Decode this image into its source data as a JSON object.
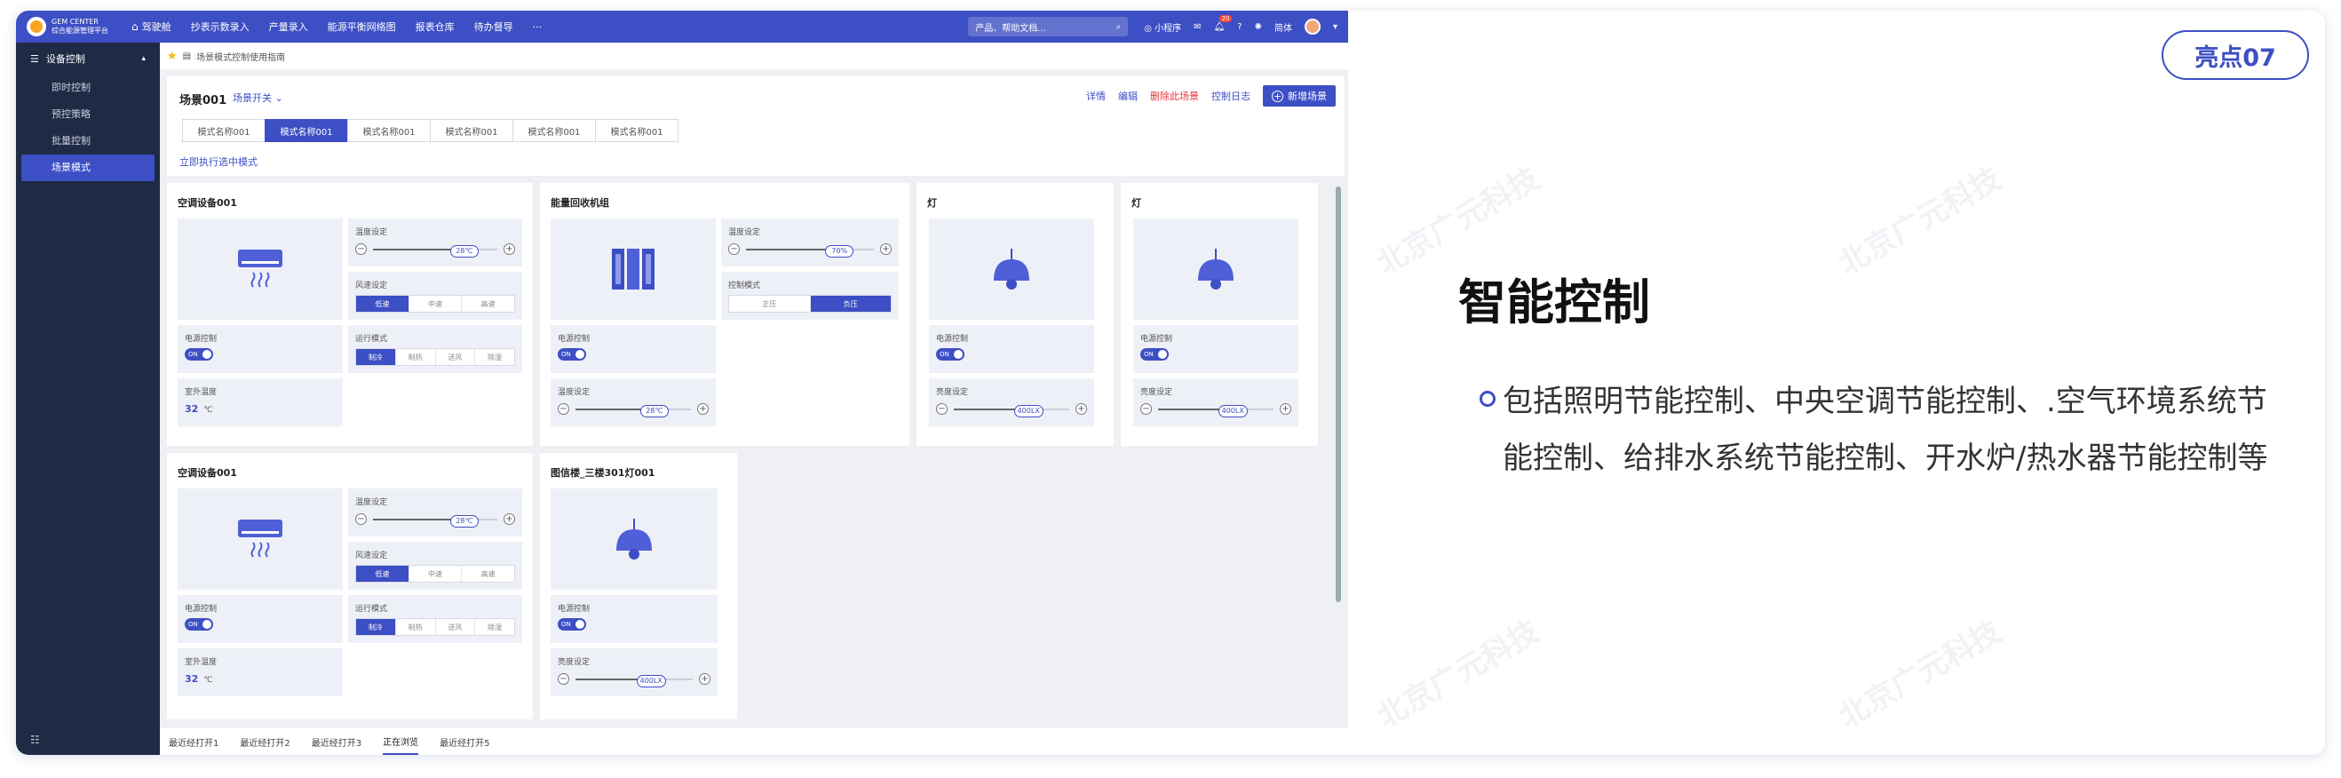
{
  "app": {
    "logo_text": "GEM CENTER",
    "logo_sub": "综合能源管理平台",
    "nav": [
      {
        "label": "驾驶舱",
        "icon": "home-icon"
      },
      {
        "label": "抄表示数录入"
      },
      {
        "label": "产量录入"
      },
      {
        "label": "能源平衡网络图"
      },
      {
        "label": "报表仓库"
      },
      {
        "label": "待办督导"
      },
      {
        "label": "···"
      }
    ],
    "search_placeholder": "产品、帮助文档...",
    "mini_program": "小程序",
    "notif_count": "20",
    "lang": "简体"
  },
  "sidebar": {
    "header": "设备控制",
    "items": [
      "即时控制",
      "预控策略",
      "批量控制",
      "场景模式"
    ],
    "active_index": 3
  },
  "breadcrumb": "场景模式控制使用指南",
  "scene": {
    "title": "场景001",
    "switch_label": "场景开关",
    "actions": [
      "详情",
      "编辑",
      "删除此场景",
      "控制日志"
    ],
    "add_label": "新增场景",
    "tabs": [
      "模式名称001",
      "模式名称001",
      "模式名称001",
      "模式名称001",
      "模式名称001",
      "模式名称001"
    ],
    "active_tab": 1,
    "exec_link": "立即执行选中模式"
  },
  "labels": {
    "temp_set": "温度设定",
    "fan_set": "风速设定",
    "power": "电源控制",
    "run_mode": "运行模式",
    "outdoor_temp": "室外温度",
    "control_mode": "控制模式",
    "brightness": "亮度设定"
  },
  "devices": {
    "ac1": {
      "title": "空调设备001",
      "temp": "28℃",
      "fan": [
        "低速",
        "中速",
        "高速"
      ],
      "fan_on": 0,
      "power": "ON",
      "modes": [
        "制冷",
        "制热",
        "送风",
        "除湿"
      ],
      "mode_on": 0,
      "outdoor": "32",
      "unit": "℃"
    },
    "recovery": {
      "title": "能量回收机组",
      "temp": "70%",
      "ctrl": [
        "正压",
        "负压"
      ],
      "ctrl_on": 1,
      "power": "ON",
      "temp2": "28℃"
    },
    "lamp1": {
      "title": "灯",
      "power": "ON",
      "bright": "400LX"
    },
    "lamp2": {
      "title": "灯",
      "power": "ON",
      "bright": "400LX"
    },
    "ac2": {
      "title": "空调设备001",
      "temp": "28℃",
      "fan": [
        "低速",
        "中速",
        "高速"
      ],
      "fan_on": 0,
      "power": "ON",
      "modes": [
        "制冷",
        "制热",
        "送风",
        "除湿"
      ],
      "mode_on": 0,
      "outdoor": "32",
      "unit": "℃"
    },
    "lamp3": {
      "title": "图信楼_三楼301灯001",
      "power": "ON",
      "bright": "400LX"
    }
  },
  "bottom_tabs": [
    "最近经打开1",
    "最近经打开2",
    "最近经打开3",
    "正在浏览",
    "最近经打开5"
  ],
  "bottom_active": 3,
  "highlight": {
    "badge": "亮点07",
    "title": "智能控制",
    "desc": "包括照明节能控制、中央空调节能控制、.空气环境系统节能控制、给排水系统节能控制、开水炉/热水器节能控制等"
  },
  "watermark": "北京广元科技",
  "colors": {
    "primary": "#3d4fc4",
    "sidebar": "#1f2a44",
    "danger": "#e8353b",
    "logo": "#f5a623"
  }
}
